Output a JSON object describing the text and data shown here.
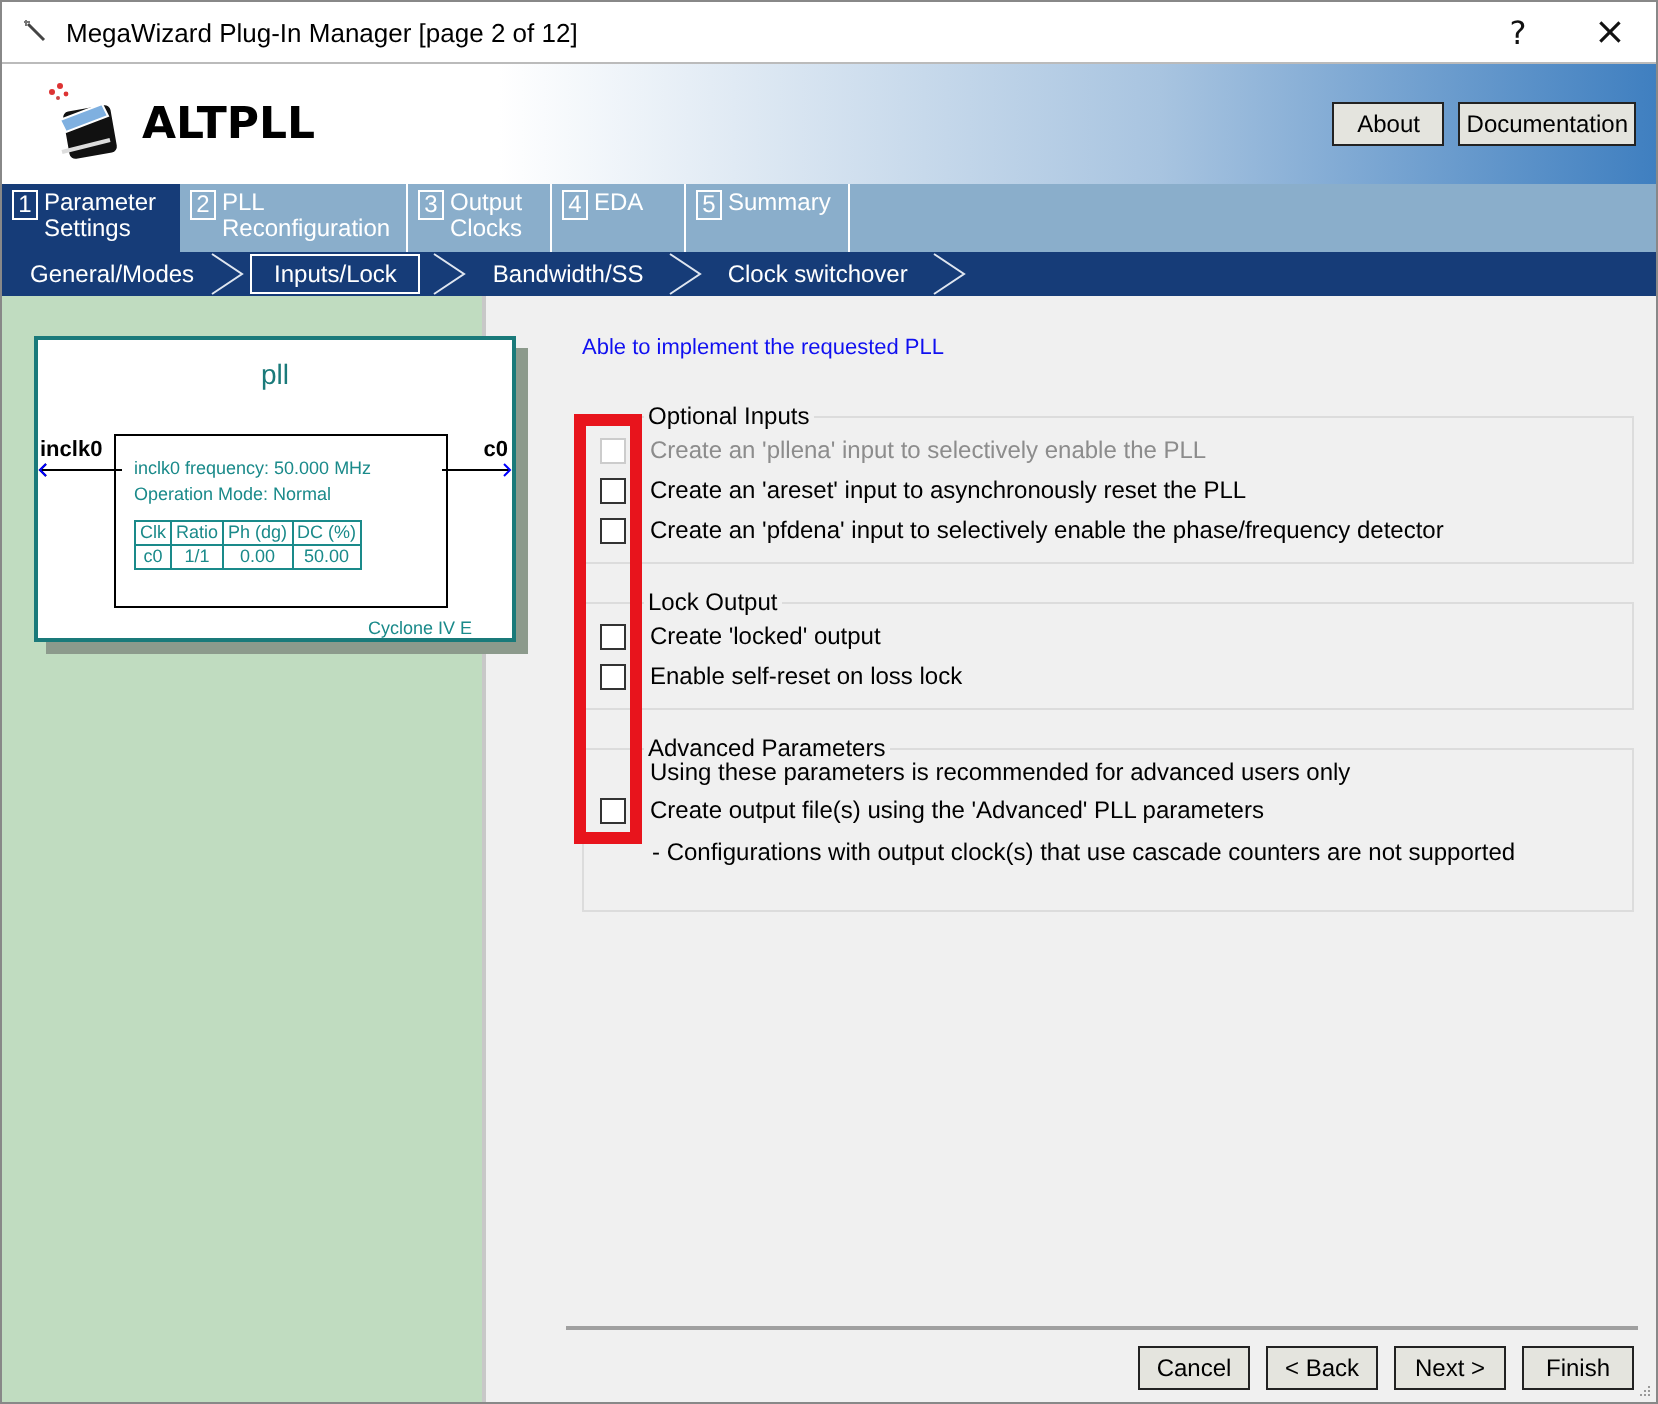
{
  "window": {
    "title": "MegaWizard Plug-In Manager [page 2 of 12]",
    "help": "?",
    "close": "×"
  },
  "header": {
    "title": "ALTPLL",
    "buttons": [
      "About",
      "Documentation"
    ]
  },
  "tabs": [
    {
      "number": "1",
      "label": "Parameter\nSettings",
      "selected": true
    },
    {
      "number": "2",
      "label": "PLL\nReconfiguration",
      "selected": false
    },
    {
      "number": "3",
      "label": "Output\nClocks",
      "selected": false
    },
    {
      "number": "4",
      "label": "EDA",
      "selected": false
    },
    {
      "number": "5",
      "label": "Summary",
      "selected": false
    }
  ],
  "steps": [
    {
      "label": "General/Modes",
      "selected": false
    },
    {
      "label": "Inputs/Lock",
      "selected": true
    },
    {
      "label": "Bandwidth/SS",
      "selected": false
    },
    {
      "label": "Clock switchover",
      "selected": false
    }
  ],
  "diagram": {
    "title": "pll",
    "input": "inclk0",
    "output": "c0",
    "info": [
      "inclk0 frequency: 50.000 MHz",
      "Operation Mode: Normal"
    ],
    "table": {
      "columns": [
        "Clk",
        "Ratio",
        "Ph (dg)",
        "DC (%)"
      ],
      "rows": [
        [
          "c0",
          "1/1",
          "0.00",
          "50.00"
        ]
      ]
    },
    "device": "Cyclone IV E"
  },
  "status_message": "Able to implement the requested PLL",
  "groups": [
    {
      "title": "Optional Inputs",
      "options": [
        {
          "label": "Create an 'pllena' input to selectively enable the PLL",
          "checked": false,
          "disabled": true
        },
        {
          "label": "Create an 'areset' input to asynchronously reset the PLL",
          "checked": false,
          "disabled": false
        },
        {
          "label": "Create an 'pfdena' input to selectively enable the phase/frequency detector",
          "checked": false,
          "disabled": false
        }
      ]
    },
    {
      "title": "Lock Output",
      "options": [
        {
          "label": "Create 'locked' output",
          "checked": false,
          "disabled": false
        },
        {
          "label": "Enable self-reset on loss lock",
          "checked": false,
          "disabled": false
        }
      ]
    },
    {
      "title": "Advanced Parameters",
      "note": "Using these parameters is recommended for advanced users only",
      "options": [
        {
          "label": "Create output file(s) using the 'Advanced' PLL parameters",
          "checked": false,
          "disabled": false
        }
      ],
      "footnote": "- Configurations with output clock(s) that use cascade counters are not supported"
    }
  ],
  "footer_buttons": [
    "Cancel",
    "< Back",
    "Next >",
    "Finish"
  ]
}
